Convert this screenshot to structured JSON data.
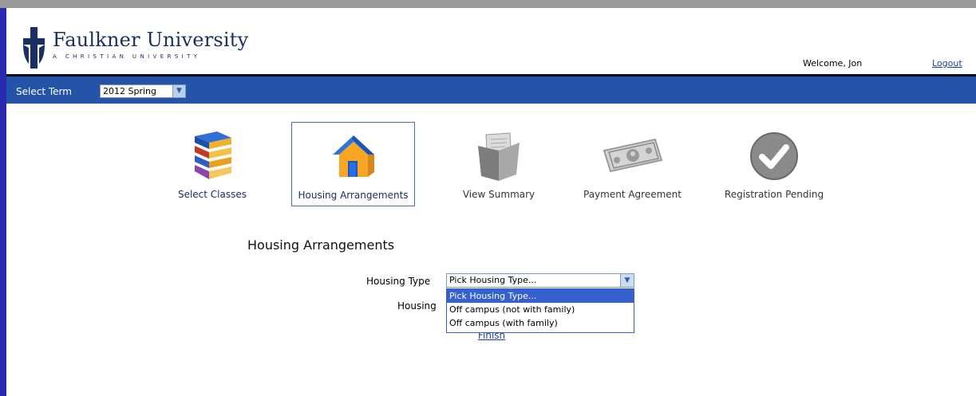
{
  "header": {
    "university_name": "Faulkner University",
    "tagline": "A CHRISTIAN UNIVERSITY",
    "welcome": "Welcome, Jon",
    "logout": "Logout"
  },
  "nav": {
    "term_label": "Select Term",
    "term_value": "2012 Spring"
  },
  "steps": [
    {
      "label": "Select Classes",
      "icon": "books-icon",
      "state": "complete"
    },
    {
      "label": "Housing Arrangements",
      "icon": "house-icon",
      "state": "active"
    },
    {
      "label": "View Summary",
      "icon": "folder-document-icon",
      "state": "pending"
    },
    {
      "label": "Payment Agreement",
      "icon": "money-icon",
      "state": "pending"
    },
    {
      "label": "Registration Pending",
      "icon": "checkmark-icon",
      "state": "pending"
    }
  ],
  "main": {
    "heading": "Housing Arrangements",
    "housing_type_label": "Housing Type",
    "housing_type_value": "Pick Housing Type...",
    "housing_label": "Housing",
    "dropdown_options": [
      "Pick Housing Type...",
      "Off campus (not with family)",
      "Off campus (with family)"
    ],
    "finish": "Finish"
  },
  "colors": {
    "navbar": "#2553a8",
    "brand_navy": "#1a2f63",
    "link": "#1a3fa8",
    "selection": "#3760cf"
  }
}
